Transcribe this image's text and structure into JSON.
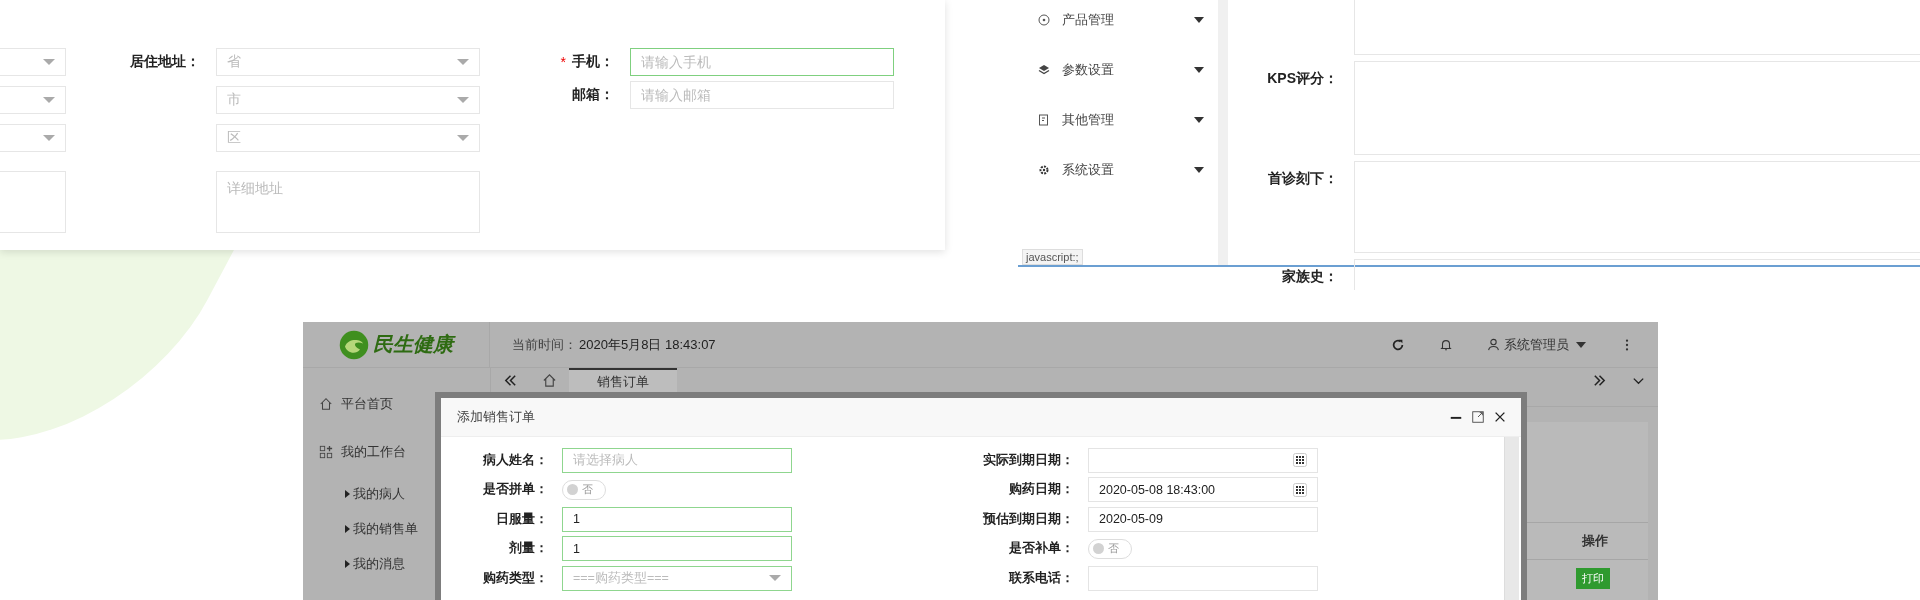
{
  "address_form": {
    "residence": {
      "label": "居住地址：",
      "selects": [
        {
          "placeholder": "省"
        },
        {
          "placeholder": "市"
        },
        {
          "placeholder": "区"
        }
      ],
      "detail": {
        "placeholder": "详细地址"
      }
    },
    "contact": [
      {
        "marker": "*",
        "label": "手机：",
        "placeholder": "请输入手机",
        "focused": true
      },
      {
        "label": "邮箱：",
        "placeholder": "请输入邮箱",
        "focused": false
      }
    ]
  },
  "menu_panel": {
    "items": [
      {
        "label": "产品管理"
      },
      {
        "label": "参数设置"
      },
      {
        "label": "其他管理"
      },
      {
        "label": "系统设置"
      }
    ],
    "status_url": "javascript:;",
    "fields": [
      {
        "label": "KPS评分："
      },
      {
        "label": "首诊刻下："
      },
      {
        "label": "家族史："
      }
    ]
  },
  "app": {
    "logo": "民生健康",
    "time_label": "当前时间：",
    "time": "2020年5月8日 18:43:07",
    "user": "系统管理员",
    "nav": [
      {
        "label": "平台首页",
        "kind": "home"
      },
      {
        "label": "我的工作台",
        "kind": "workbench"
      },
      {
        "label": "我的病人",
        "kind": "sub"
      },
      {
        "label": "我的销售单",
        "kind": "sub"
      },
      {
        "label": "我的消息",
        "kind": "sub"
      }
    ],
    "tabs": [
      {
        "label": "销售订单",
        "selected": true
      }
    ],
    "table": {
      "columns": [
        "操作"
      ],
      "rows": [
        {
          "action": "打印"
        }
      ]
    },
    "modal": {
      "title": "添加销售订单",
      "left_fields": [
        {
          "label": "病人姓名：",
          "kind": "input",
          "placeholder": "请选择病人",
          "highlighted": true
        },
        {
          "label": "是否拼单：",
          "kind": "switch",
          "on": false,
          "text": "否"
        },
        {
          "label": "日服量：",
          "kind": "input",
          "value": "1",
          "highlighted": true
        },
        {
          "label": "剂量：",
          "kind": "input",
          "value": "1",
          "highlighted": true
        },
        {
          "label": "购药类型：",
          "kind": "select",
          "placeholder": "===购药类型===",
          "highlighted": true
        }
      ],
      "right_fields": [
        {
          "label": "实际到期日期：",
          "kind": "date",
          "highlighted": false
        },
        {
          "label": "购药日期：",
          "kind": "date",
          "value": "2020-05-08 18:43:00",
          "highlighted": false
        },
        {
          "label": "预估到期日期：",
          "kind": "input",
          "value": "2020-05-09",
          "highlighted": false
        },
        {
          "label": "是否补单：",
          "kind": "switch",
          "on": false,
          "text": "否"
        },
        {
          "label": "联系电话：",
          "kind": "input",
          "highlighted": false
        }
      ]
    }
  }
}
